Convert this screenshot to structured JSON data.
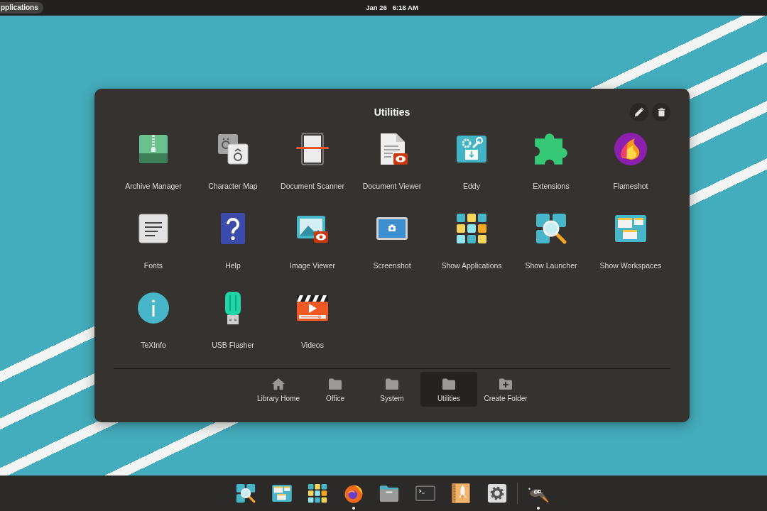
{
  "top_bar": {
    "applications_button": "pplications",
    "date": "Jan 26",
    "time": "6:18 AM"
  },
  "folder_window": {
    "title": "Utilities",
    "apps": [
      {
        "label": "Archive Manager"
      },
      {
        "label": "Character Map"
      },
      {
        "label": "Document Scanner"
      },
      {
        "label": "Document Viewer"
      },
      {
        "label": "Eddy"
      },
      {
        "label": "Extensions"
      },
      {
        "label": "Flameshot"
      },
      {
        "label": "Fonts"
      },
      {
        "label": "Help"
      },
      {
        "label": "Image Viewer"
      },
      {
        "label": "Screenshot"
      },
      {
        "label": "Show Applications"
      },
      {
        "label": "Show Launcher"
      },
      {
        "label": "Show Workspaces"
      },
      {
        "label": "TeXInfo"
      },
      {
        "label": "USB Flasher"
      },
      {
        "label": "Videos"
      }
    ],
    "folders": [
      {
        "label": "Library Home",
        "kind": "home",
        "selected": false
      },
      {
        "label": "Office",
        "kind": "folder",
        "selected": false
      },
      {
        "label": "System",
        "kind": "folder",
        "selected": false
      },
      {
        "label": "Utilities",
        "kind": "folder",
        "selected": true
      },
      {
        "label": "Create Folder",
        "kind": "create",
        "selected": false
      }
    ]
  },
  "dock": {
    "pinned": [
      {
        "running": false
      },
      {
        "running": false
      },
      {
        "running": false
      },
      {
        "running": true
      },
      {
        "running": false
      },
      {
        "running": false
      },
      {
        "running": false
      },
      {
        "running": false
      }
    ],
    "other": [
      {
        "running": true
      }
    ]
  }
}
